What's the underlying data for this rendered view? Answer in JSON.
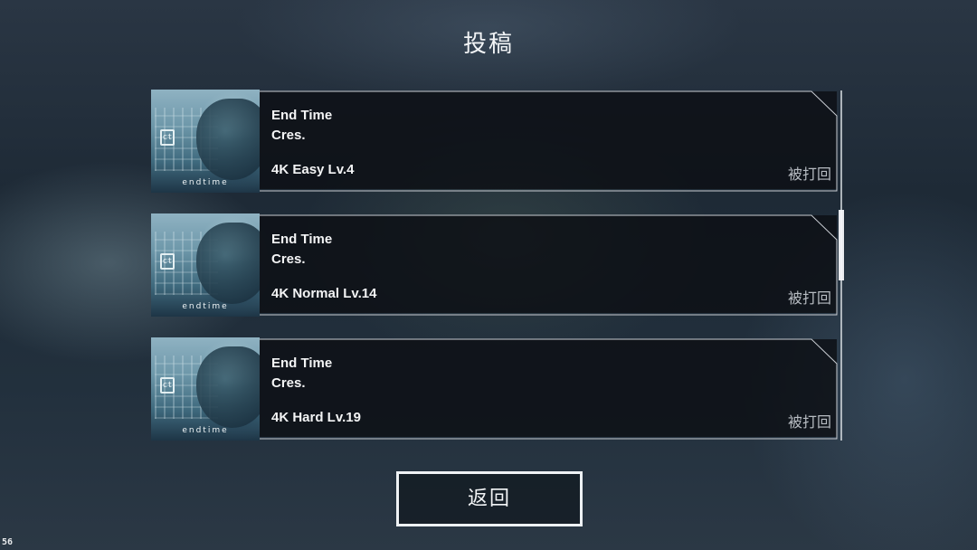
{
  "header": {
    "title": "投稿"
  },
  "submissions": [
    {
      "cover_text": "endtime",
      "cover_logo": "ct",
      "title": "End Time",
      "artist": "Cres.",
      "level": "4K Easy Lv.4",
      "status": "被打回"
    },
    {
      "cover_text": "endtime",
      "cover_logo": "ct",
      "title": "End Time",
      "artist": "Cres.",
      "level": "4K Normal Lv.14",
      "status": "被打回"
    },
    {
      "cover_text": "endtime",
      "cover_logo": "ct",
      "title": "End Time",
      "artist": "Cres.",
      "level": "4K Hard Lv.19",
      "status": "被打回"
    }
  ],
  "footer": {
    "back_label": "返回"
  },
  "debug": {
    "fps": "56"
  },
  "colors": {
    "card_background": "#0c0f14",
    "card_border": "#c8ccd2",
    "text_primary": "#f3f4f5",
    "text_status": "#b7bcc2",
    "button_border": "#eef1f4"
  }
}
